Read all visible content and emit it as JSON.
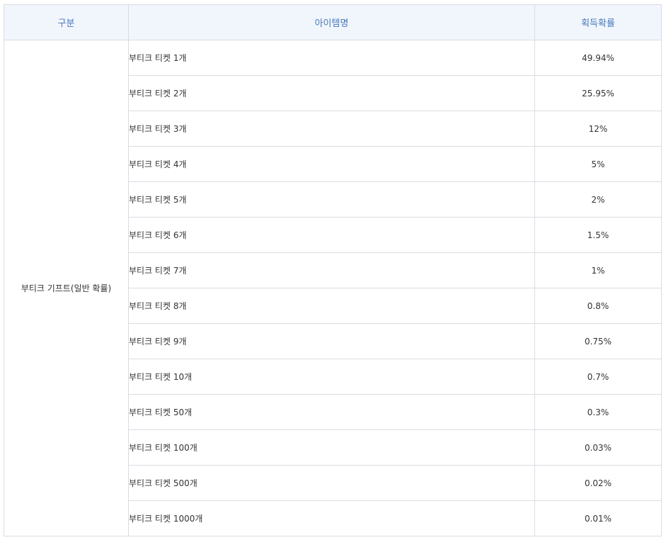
{
  "table": {
    "headers": {
      "category": "구분",
      "item": "아이템명",
      "rate": "획득확률"
    },
    "category": "부티크 기프트(일반 확률)",
    "rows": [
      {
        "item": "부티크 티켓 1개",
        "rate": "49.94%"
      },
      {
        "item": "부티크 티켓 2개",
        "rate": "25.95%"
      },
      {
        "item": "부티크 티켓 3개",
        "rate": "12%"
      },
      {
        "item": "부티크 티켓 4개",
        "rate": "5%"
      },
      {
        "item": "부티크 티켓 5개",
        "rate": "2%"
      },
      {
        "item": "부티크 티켓 6개",
        "rate": "1.5%"
      },
      {
        "item": "부티크 티켓 7개",
        "rate": "1%"
      },
      {
        "item": "부티크 티켓 8개",
        "rate": "0.8%"
      },
      {
        "item": "부티크 티켓 9개",
        "rate": "0.75%"
      },
      {
        "item": "부티크 티켓 10개",
        "rate": "0.7%"
      },
      {
        "item": "부티크 티켓 50개",
        "rate": "0.3%"
      },
      {
        "item": "부티크 티켓 100개",
        "rate": "0.03%"
      },
      {
        "item": "부티크 티켓 500개",
        "rate": "0.02%"
      },
      {
        "item": "부티크 티켓 1000개",
        "rate": "0.01%"
      }
    ]
  }
}
